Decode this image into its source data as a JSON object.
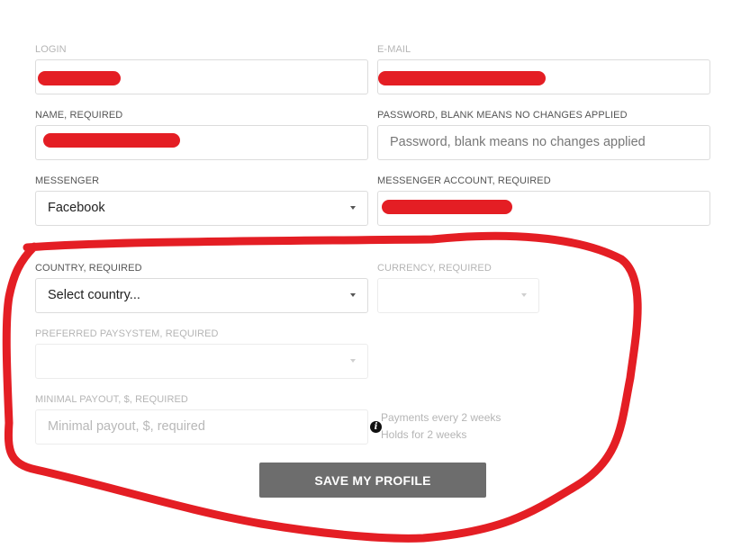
{
  "form": {
    "login": {
      "label": "LOGIN"
    },
    "email": {
      "label": "E-MAIL"
    },
    "name": {
      "label": "NAME, REQUIRED"
    },
    "password": {
      "label": "PASSWORD, BLANK MEANS NO CHANGES APPLIED",
      "placeholder": "Password, blank means no changes applied"
    },
    "messenger": {
      "label": "MESSENGER",
      "value": "Facebook"
    },
    "messenger_account": {
      "label": "MESSENGER ACCOUNT, REQUIRED"
    },
    "country": {
      "label": "COUNTRY, REQUIRED",
      "value": "Select country..."
    },
    "currency": {
      "label": "CURRENCY, REQUIRED"
    },
    "paysystem": {
      "label": "PREFERRED PAYSYSTEM, REQUIRED"
    },
    "minimal_payout": {
      "label": "MINIMAL PAYOUT, $, REQUIRED",
      "placeholder": "Minimal payout, $, required"
    },
    "payout_notes": [
      "Payments every 2 weeks",
      "Holds for 2 weeks"
    ],
    "save_label": "SAVE MY PROFILE"
  },
  "colors": {
    "redaction": "#e41e24",
    "button_bg": "#6d6d6d",
    "disabled_text": "#b5b5b5"
  }
}
